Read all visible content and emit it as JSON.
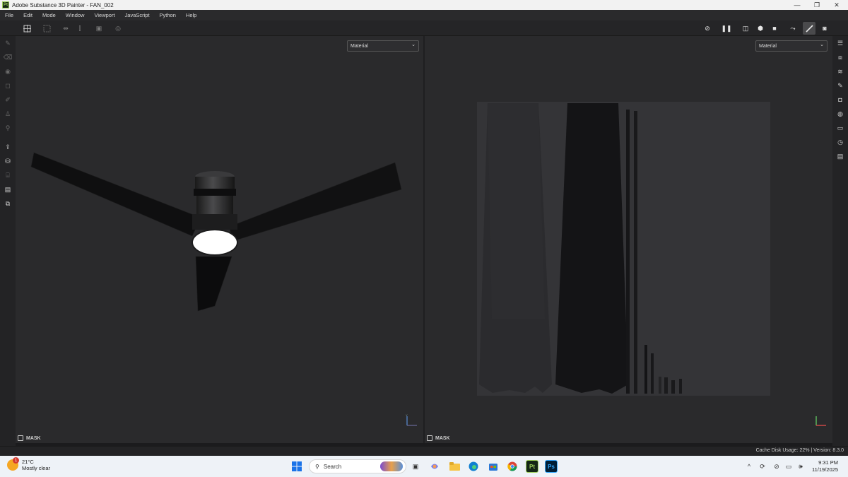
{
  "window": {
    "app_icon": "Pt",
    "title": "Adobe Substance 3D Painter - FAN_002",
    "controls": {
      "minimize": "—",
      "maximize": "❐",
      "close": "✕"
    }
  },
  "menu": [
    "File",
    "Edit",
    "Mode",
    "Window",
    "Viewport",
    "JavaScript",
    "Python",
    "Help"
  ],
  "viewports": {
    "left": {
      "display_mode": "Material",
      "mask_label": "MASK"
    },
    "right": {
      "display_mode": "Material",
      "mask_label": "MASK"
    }
  },
  "status": {
    "cache_text": "Cache Disk Usage:",
    "cache_value": "22%",
    "version_text": "| Version: 8.3.0"
  },
  "taskbar": {
    "weather_temp": "21°C",
    "weather_desc": "Mostly clear",
    "weather_badge": "1",
    "search_placeholder": "Search",
    "time": "9:31 PM",
    "date": "11/19/2025",
    "pinned": [
      "windows-start",
      "task-view",
      "copilot",
      "file-explorer",
      "edge",
      "microsoft-store",
      "chrome",
      "substance-painter",
      "photoshop"
    ]
  },
  "colors": {
    "titlebar_bg": "#f2f2f2",
    "ui_bg": "#2a2a2c",
    "panel_bg": "#232325",
    "uv_bg": "#343437",
    "painter_green": "#9ed05a",
    "photoshop_blue": "#31a8ff",
    "taskbar_bg": "#eef2f7"
  }
}
